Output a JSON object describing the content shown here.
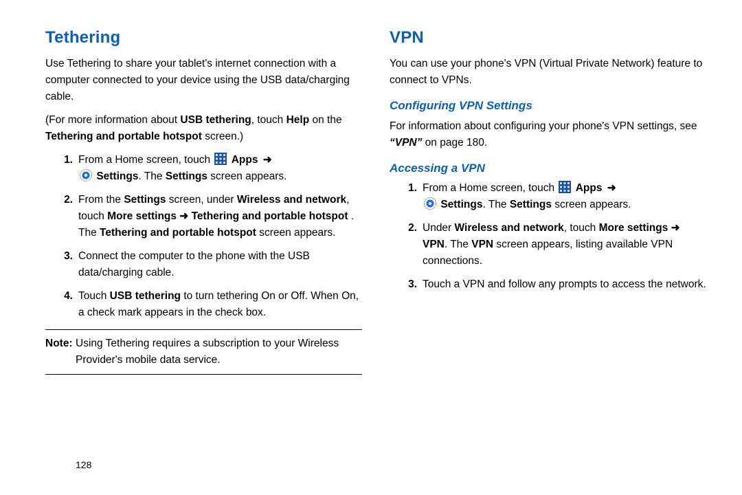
{
  "page_number": "128",
  "left": {
    "title": "Tethering",
    "p1": "Use Tethering to share your tablet's internet connection with a computer connected to your device using the USB data/charging cable.",
    "p2_pre": "(For more information about ",
    "p2_b1": "USB tethering",
    "p2_mid": ", touch ",
    "p2_b2": "Help",
    "p2_mid2": " on the ",
    "p2_b3": "Tethering and portable hotspot",
    "p2_post": " screen.)",
    "step1_num": "1.",
    "step1_pre": "From a Home screen, touch ",
    "step1_apps": "Apps",
    "step1_arrow": " ➜",
    "step1_settings": "Settings",
    "step1_post1": ". The ",
    "step1_post_b": "Settings",
    "step1_post2": " screen appears.",
    "step2_num": "2.",
    "step2_t1": "From the ",
    "step2_b1": "Settings",
    "step2_t2": " screen, under ",
    "step2_b2": "Wireless and network",
    "step2_t3": ", touch ",
    "step2_b3": "More settings ➜ Tethering and portable hotspot",
    "step2_t4": " . The ",
    "step2_b4": "Tethering and portable hotspot",
    "step2_t5": " screen appears.",
    "step3_num": "3.",
    "step3": "Connect the computer to the phone with the USB data/charging cable.",
    "step4_num": "4.",
    "step4_t1": "Touch ",
    "step4_b1": "USB tethering",
    "step4_t2": " to turn tethering On or Off. When On, a check mark appears in the check box.",
    "note_label": "Note:",
    "note_text": "Using Tethering requires a subscription to your Wireless Provider's mobile data service."
  },
  "right": {
    "title": "VPN",
    "p1": "You can use your phone's VPN (Virtual Private Network) feature to connect to VPNs.",
    "sub1": "Configuring VPN Settings",
    "sub1_p_t1": "For information about configuring your phone's VPN settings, see ",
    "sub1_p_b1": "“VPN”",
    "sub1_p_t2": " on page 180.",
    "sub2": "Accessing a VPN",
    "step1_num": "1.",
    "step1_pre": "From a Home screen, touch ",
    "step1_apps": "Apps",
    "step1_arrow": " ➜",
    "step1_settings": "Settings",
    "step1_post1": ". The ",
    "step1_post_b": "Settings",
    "step1_post2": " screen appears.",
    "step2_num": "2.",
    "step2_t1": "Under ",
    "step2_b1": "Wireless and network",
    "step2_t2": ", touch ",
    "step2_b2": "More settings ➜ VPN",
    "step2_t3": ". The ",
    "step2_b3": "VPN",
    "step2_t4": " screen appears, listing available VPN connections.",
    "step3_num": "3.",
    "step3": "Touch a VPN and follow any prompts to access the network."
  }
}
